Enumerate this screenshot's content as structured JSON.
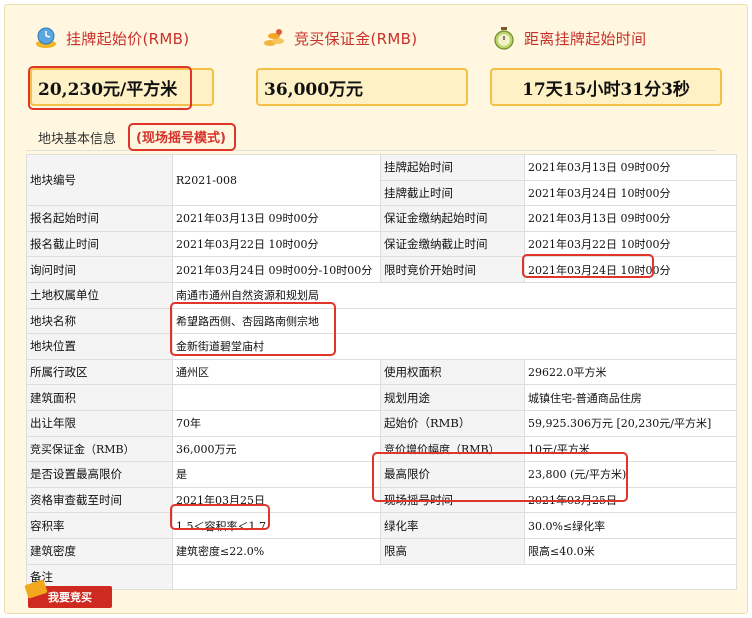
{
  "header": {
    "start_price_label": "挂牌起始价(RMB)",
    "start_price_value": "20,230元/平方米",
    "deposit_label": "竞买保证金(RMB)",
    "deposit_value": "36,000万元",
    "countdown_label": "距离挂牌起始时间",
    "countdown_value": "17天15小时31分3秒",
    "icons": [
      "money-clock-icon",
      "gold-coins-icon",
      "timer-icon"
    ],
    "accent_color": "#c9302c",
    "box_border_color": "#f4c148",
    "box_fill_color": "#fff1c6"
  },
  "tab": {
    "title": "地块基本信息",
    "mode": "(现场摇号模式)"
  },
  "table": {
    "rows": [
      [
        "地块编号",
        "R2021-008",
        "挂牌起始时间",
        "2021年03月13日 09时00分"
      ],
      [
        "",
        "",
        "挂牌截止时间",
        "2021年03月24日 10时00分"
      ],
      [
        "报名起始时间",
        "2021年03月13日 09时00分",
        "保证金缴纳起始时间",
        "2021年03月13日 09时00分"
      ],
      [
        "报名截止时间",
        "2021年03月22日 10时00分",
        "保证金缴纳截止时间",
        "2021年03月22日 10时00分"
      ],
      [
        "询问时间",
        "2021年03月24日 09时00分-10时00分",
        "限时竞价开始时间",
        "2021年03月24日 10时00分"
      ],
      [
        "土地权属单位",
        "南通市通州自然资源和规划局"
      ],
      [
        "地块名称",
        "希望路西侧、杏园路南侧宗地"
      ],
      [
        "地块位置",
        "金新街道碧堂庙村"
      ],
      [
        "所属行政区",
        "通州区",
        "使用权面积",
        "29622.0平方米"
      ],
      [
        "建筑面积",
        "",
        "规划用途",
        "城镇住宅-普通商品住房"
      ],
      [
        "出让年限",
        "70年",
        "起始价（RMB）",
        "59,925.306万元 [20,230元/平方米]"
      ],
      [
        "竞买保证金（RMB）",
        "36,000万元",
        "竞价增价幅度（RMB）",
        "10元/平方米"
      ],
      [
        "是否设置最高限价",
        "是",
        "最高限价",
        "23,800 (元/平方米)"
      ],
      [
        "资格审查截至时间",
        "2021年03月25日",
        "现场摇号时间",
        "2021年03月25日"
      ],
      [
        "容积率",
        "1.5＜容积率＜1.7",
        "绿化率",
        "30.0%≤绿化率"
      ],
      [
        "建筑密度",
        "建筑密度≤22.0%",
        "限高",
        "限高≤40.0米"
      ],
      [
        "备注",
        ""
      ]
    ]
  },
  "bid_button": {
    "label": "我要竞买",
    "color": "#cf2a1f"
  }
}
